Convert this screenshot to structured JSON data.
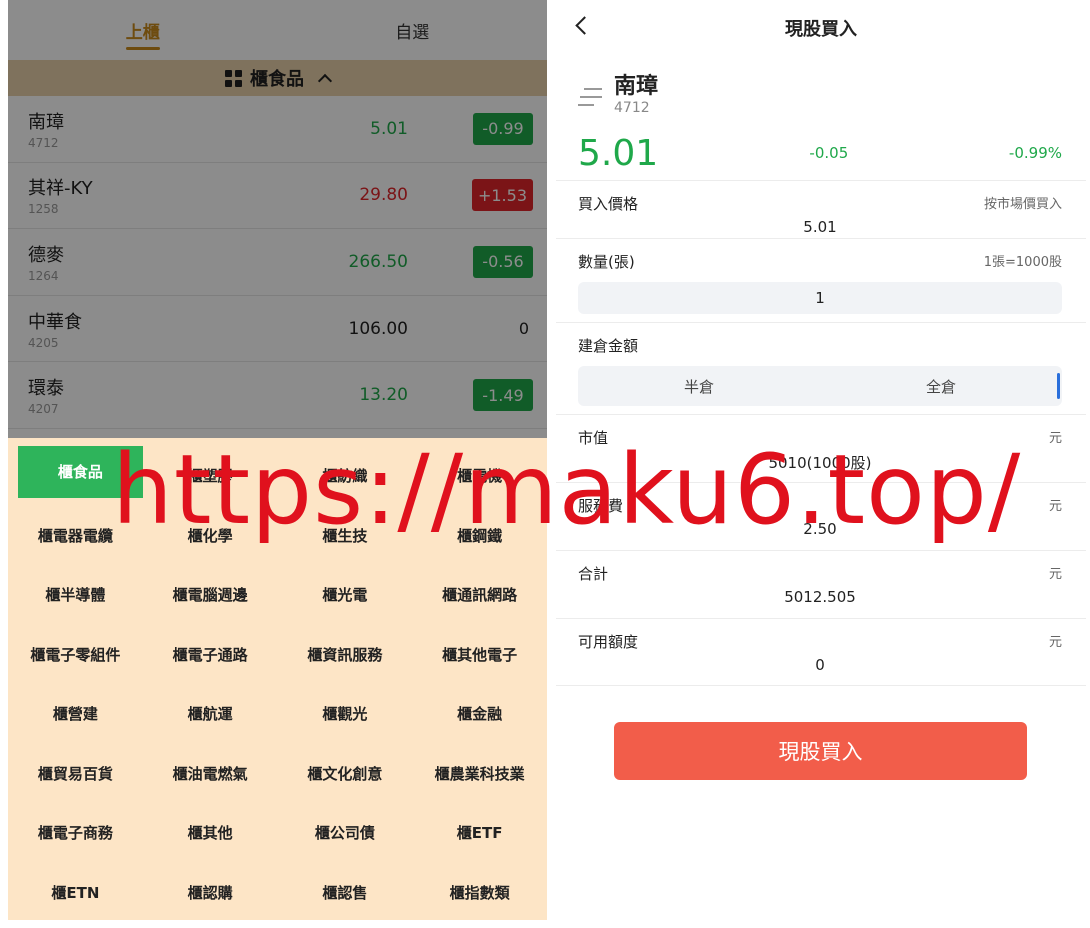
{
  "left": {
    "tabs": [
      "上櫃",
      "自選"
    ],
    "category": "櫃食品",
    "stocks": [
      {
        "name": "南璋",
        "code": "4712",
        "price": "5.01",
        "change": "-0.99",
        "dir": "down"
      },
      {
        "name": "其祥-KY",
        "code": "1258",
        "price": "29.80",
        "change": "+1.53",
        "dir": "up"
      },
      {
        "name": "德麥",
        "code": "1264",
        "price": "266.50",
        "change": "-0.56",
        "dir": "down"
      },
      {
        "name": "中華食",
        "code": "4205",
        "price": "106.00",
        "change": "0",
        "dir": "flat"
      },
      {
        "name": "環泰",
        "code": "4207",
        "price": "13.20",
        "change": "-1.49",
        "dir": "down"
      }
    ],
    "sectors": [
      "櫃食品",
      "櫃塑膠",
      "櫃紡織",
      "櫃電機",
      "櫃電器電纜",
      "櫃化學",
      "櫃生技",
      "櫃鋼鐵",
      "櫃半導體",
      "櫃電腦週邊",
      "櫃光電",
      "櫃通訊網路",
      "櫃電子零組件",
      "櫃電子通路",
      "櫃資訊服務",
      "櫃其他電子",
      "櫃營建",
      "櫃航運",
      "櫃觀光",
      "櫃金融",
      "櫃貿易百貨",
      "櫃油電燃氣",
      "櫃文化創意",
      "櫃農業科技業",
      "櫃電子商務",
      "櫃其他",
      "櫃公司債",
      "櫃ETF",
      "櫃ETN",
      "櫃認購",
      "櫃認售",
      "櫃指數類"
    ]
  },
  "right": {
    "title": "現股買入",
    "stock": {
      "name": "南璋",
      "code": "4712"
    },
    "price": "5.01",
    "change": "-0.05",
    "change_pct": "-0.99%",
    "buy_price_label": "買入價格",
    "market_price_label": "按市場價買入",
    "buy_price_value": "5.01",
    "qty_label": "數量(張)",
    "qty_hint": "1張=1000股",
    "qty_value": "1",
    "position_label": "建倉金額",
    "half": "半倉",
    "full": "全倉",
    "market_value_label": "市值",
    "market_value": "5010(1000股)",
    "fee_label": "服務費",
    "fee_value": "2.50",
    "total_label": "合計",
    "total_value": "5012.505",
    "available_label": "可用額度",
    "available_value": "0",
    "unit": "元",
    "buy_button": "現股買入"
  },
  "watermark": "https://maku6.top/",
  "colors": {
    "up": "#e0262a",
    "down": "#1fa84a",
    "accent": "#c98a1c",
    "buy": "#f25d4a"
  }
}
